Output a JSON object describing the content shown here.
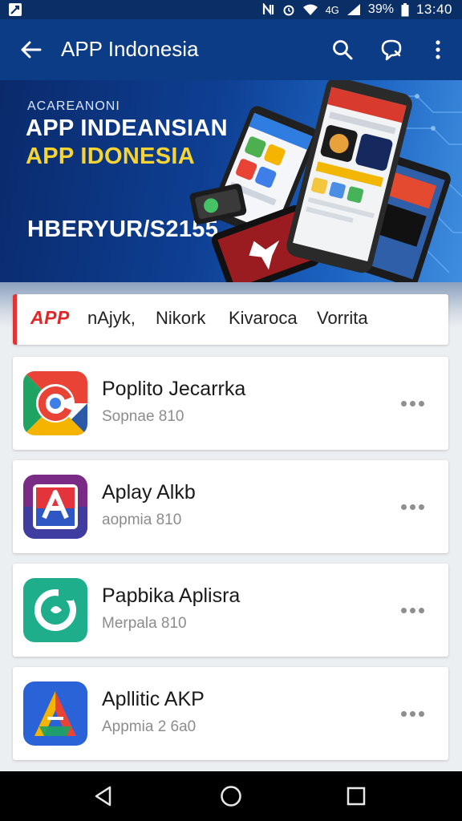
{
  "status_bar": {
    "time": "13:40",
    "battery": "39%",
    "signal_label": "4G"
  },
  "app_bar": {
    "title": "APP Indonesia"
  },
  "banner": {
    "small_text": "ACAREANONI",
    "title_line1": "APP INDEANSIAN",
    "title_line2": "APP IDONESIA",
    "code_text": "HBERYUR/S2155",
    "title_line2_color": "#f6d433"
  },
  "tabs": {
    "logo": "APP",
    "items": [
      "nAjyk,",
      "Nikork",
      "Kivaroca",
      "Vorrita"
    ],
    "accent_color": "#e23434"
  },
  "apps": [
    {
      "name": "Poplito Jecarrka",
      "meta": "Sopnae 810"
    },
    {
      "name": "Aplay Alkb",
      "meta": "aopmia 810"
    },
    {
      "name": "Papbika Aplisra",
      "meta": "Merpala 810"
    },
    {
      "name": "Apllitic AKP",
      "meta": "Appmia 2 6a0"
    }
  ],
  "icons": {
    "back": "arrow-left-icon",
    "search": "search-icon",
    "chat": "chat-search-icon",
    "more": "more-vertical-icon",
    "item_more": "more-horizontal-icon"
  }
}
